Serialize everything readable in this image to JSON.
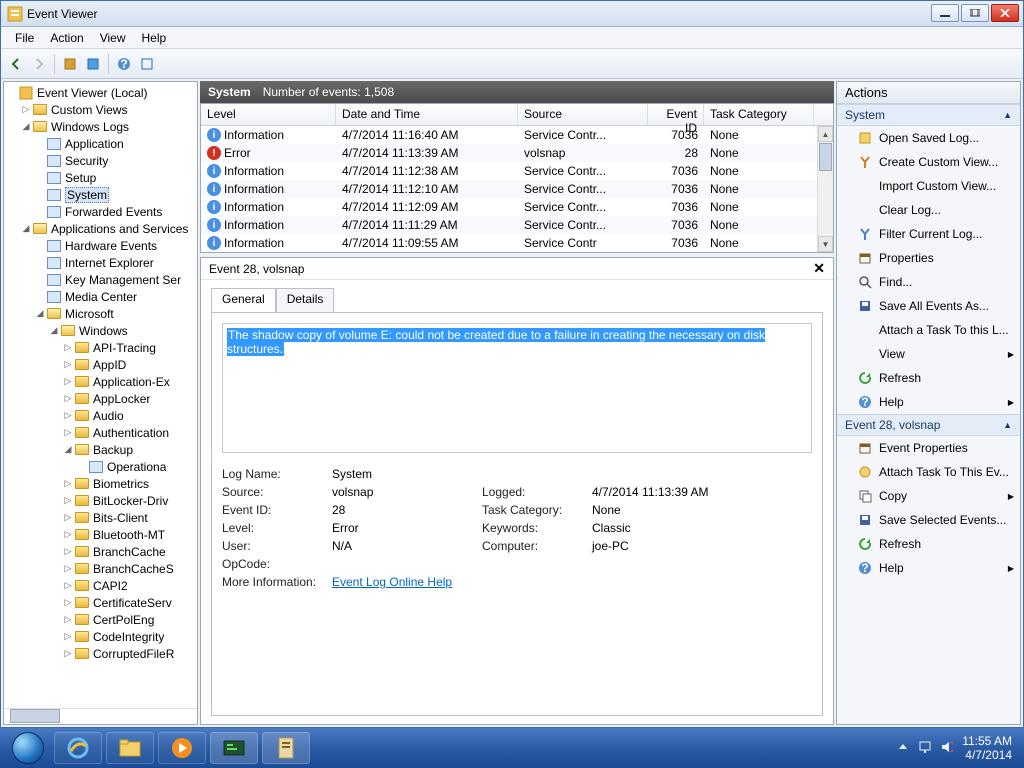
{
  "window": {
    "title": "Event Viewer"
  },
  "menu": {
    "file": "File",
    "action": "Action",
    "view": "View",
    "help": "Help"
  },
  "tree": {
    "root": "Event Viewer (Local)",
    "custom": "Custom Views",
    "winlogs": "Windows Logs",
    "wl": {
      "app": "Application",
      "sec": "Security",
      "setup": "Setup",
      "sys": "System",
      "fwd": "Forwarded Events"
    },
    "appsvc": "Applications and Services",
    "as": {
      "hw": "Hardware Events",
      "ie": "Internet Explorer",
      "kms": "Key Management Ser",
      "mc": "Media Center",
      "ms": "Microsoft",
      "win": "Windows",
      "nodes": [
        "API-Tracing",
        "AppID",
        "Application-Ex",
        "AppLocker",
        "Audio",
        "Authentication",
        "Backup",
        "Biometrics",
        "BitLocker-Driv",
        "Bits-Client",
        "Bluetooth-MT",
        "BranchCache",
        "BranchCacheS",
        "CAPI2",
        "CertificateServ",
        "CertPolEng",
        "CodeIntegrity",
        "CorruptedFileR"
      ],
      "backup_child": "Operationa"
    }
  },
  "mid": {
    "section": "System",
    "count_label": "Number of events: 1,508",
    "cols": {
      "level": "Level",
      "date": "Date and Time",
      "source": "Source",
      "eid": "Event ID",
      "cat": "Task Category"
    },
    "rows": [
      {
        "lvl": "Information",
        "dt": "4/7/2014 11:16:40 AM",
        "src": "Service Contr...",
        "eid": "7036",
        "cat": "None",
        "t": "i"
      },
      {
        "lvl": "Error",
        "dt": "4/7/2014 11:13:39 AM",
        "src": "volsnap",
        "eid": "28",
        "cat": "None",
        "t": "e"
      },
      {
        "lvl": "Information",
        "dt": "4/7/2014 11:12:38 AM",
        "src": "Service Contr...",
        "eid": "7036",
        "cat": "None",
        "t": "i"
      },
      {
        "lvl": "Information",
        "dt": "4/7/2014 11:12:10 AM",
        "src": "Service Contr...",
        "eid": "7036",
        "cat": "None",
        "t": "i"
      },
      {
        "lvl": "Information",
        "dt": "4/7/2014 11:12:09 AM",
        "src": "Service Contr...",
        "eid": "7036",
        "cat": "None",
        "t": "i"
      },
      {
        "lvl": "Information",
        "dt": "4/7/2014 11:11:29 AM",
        "src": "Service Contr...",
        "eid": "7036",
        "cat": "None",
        "t": "i"
      },
      {
        "lvl": "Information",
        "dt": "4/7/2014 11:09:55 AM",
        "src": "Service Contr",
        "eid": "7036",
        "cat": "None",
        "t": "i"
      }
    ]
  },
  "detail": {
    "title": "Event 28, volsnap",
    "tabs": {
      "general": "General",
      "details": "Details"
    },
    "message": "The shadow copy of volume E: could not be created due to a failure in creating the necessary on disk structures.",
    "kv": {
      "logname_k": "Log Name:",
      "logname_v": "System",
      "source_k": "Source:",
      "source_v": "volsnap",
      "logged_k": "Logged:",
      "logged_v": "4/7/2014 11:13:39 AM",
      "eid_k": "Event ID:",
      "eid_v": "28",
      "cat_k": "Task Category:",
      "cat_v": "None",
      "level_k": "Level:",
      "level_v": "Error",
      "kw_k": "Keywords:",
      "kw_v": "Classic",
      "user_k": "User:",
      "user_v": "N/A",
      "comp_k": "Computer:",
      "comp_v": "joe-PC",
      "op_k": "OpCode:",
      "more_k": "More Information:",
      "more_v": "Event Log Online Help"
    }
  },
  "actions": {
    "title": "Actions",
    "sec1": "System",
    "items1": [
      "Open Saved Log...",
      "Create Custom View...",
      "Import Custom View...",
      "Clear Log...",
      "Filter Current Log...",
      "Properties",
      "Find...",
      "Save All Events As...",
      "Attach a Task To this L...",
      "View",
      "Refresh",
      "Help"
    ],
    "sec2": "Event 28, volsnap",
    "items2": [
      "Event Properties",
      "Attach Task To This Ev...",
      "Copy",
      "Save Selected Events...",
      "Refresh",
      "Help"
    ]
  },
  "tray": {
    "time": "11:55 AM",
    "date": "4/7/2014"
  }
}
